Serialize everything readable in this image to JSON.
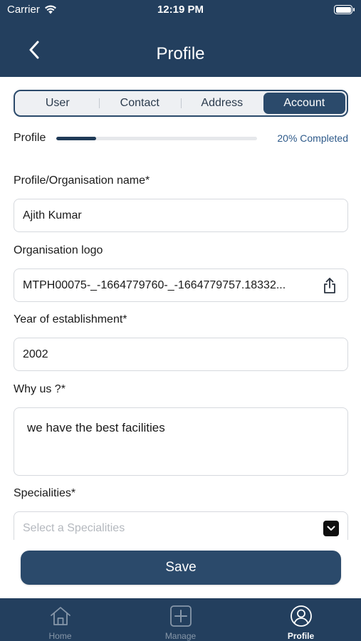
{
  "status_bar": {
    "carrier": "Carrier",
    "time": "12:19 PM"
  },
  "header": {
    "title": "Profile",
    "background": "#233f5e"
  },
  "tabs": [
    {
      "label": "User",
      "active": false
    },
    {
      "label": "Contact",
      "active": false
    },
    {
      "label": "Address",
      "active": false
    },
    {
      "label": "Account",
      "active": true
    }
  ],
  "progress": {
    "label": "Profile",
    "percent": 20,
    "text": "20% Completed"
  },
  "form": {
    "name": {
      "label": "Profile/Organisation name*",
      "value": "Ajith Kumar"
    },
    "logo": {
      "label": "Organisation logo",
      "value": "MTPH00075-_-1664779760-_-1664779757.18332..."
    },
    "year": {
      "label": "Year of establishment*",
      "value": "2002"
    },
    "why_us": {
      "label": "Why us ?*",
      "value": "we have the best facilities"
    },
    "specialities": {
      "label": "Specialities*",
      "placeholder": "Select a Specialities"
    }
  },
  "save_button": {
    "label": "Save"
  },
  "tabbar": [
    {
      "label": "Home",
      "icon": "home-icon",
      "active": false
    },
    {
      "label": "Manage",
      "icon": "plus-square-icon",
      "active": false
    },
    {
      "label": "Profile",
      "icon": "user-circle-icon",
      "active": true
    }
  ],
  "colors": {
    "primary": "#233f5e",
    "accent": "#2b4a6b",
    "progress_text": "#2e5a8a"
  }
}
